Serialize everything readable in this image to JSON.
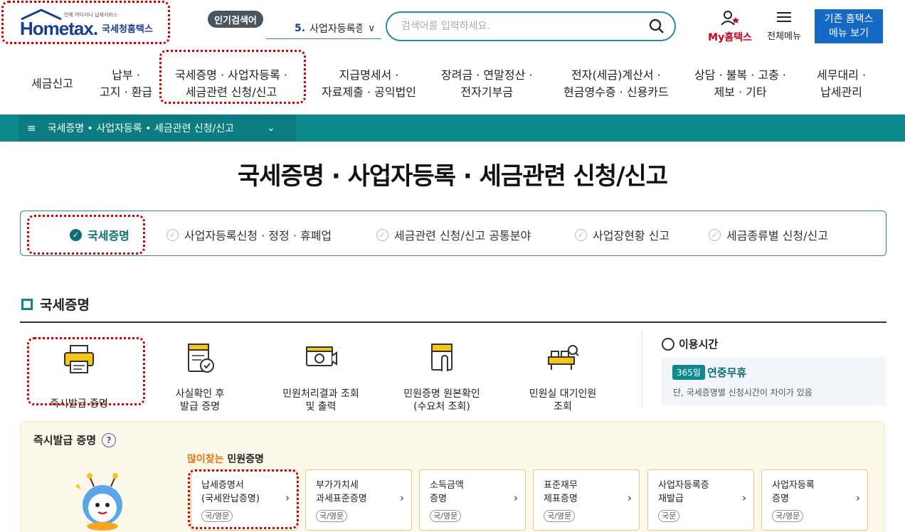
{
  "header": {
    "logo_main": "Hometax.",
    "logo_sub": "국세청홈택스",
    "logo_tiny": "언제 어디서나 납세서비스",
    "popular_badge": "인기검색어",
    "popular_num": "5.",
    "popular_text": "사업자등록증",
    "search_placeholder": "검색어를 입력하세요.",
    "my_label": "My홈택스",
    "all_menu_label": "전체메뉴",
    "old_btn_line1": "기존 홈택스",
    "old_btn_line2": "메뉴 보기"
  },
  "gnb": [
    {
      "l1": "세금신고",
      "l2": ""
    },
    {
      "l1": "납부 ·",
      "l2": "고지 · 환급"
    },
    {
      "l1": "국세증명 · 사업자등록 ·",
      "l2": "세금관련 신청/신고"
    },
    {
      "l1": "지급명세서 ·",
      "l2": "자료제출 · 공익법인"
    },
    {
      "l1": "장려금 · 연말정산 ·",
      "l2": "전자기부금"
    },
    {
      "l1": "전자(세금)계산서 ·",
      "l2": "현금영수증 · 신용카드"
    },
    {
      "l1": "상담 · 불복 · 고충 ·",
      "l2": "제보 · 기타"
    },
    {
      "l1": "세무대리 ·",
      "l2": "납세관리"
    }
  ],
  "breadcrumb": {
    "label": "국세증명 • 사업자등록 • 세금관련 신청/신고"
  },
  "page_title": "국세증명 · 사업자등록 · 세금관련 신청/신고",
  "tabs": [
    {
      "label": "국세증명",
      "active": true
    },
    {
      "label": "사업자등록신청 · 정정 · 휴폐업",
      "active": false
    },
    {
      "label": "세금관련 신청/신고 공통분야",
      "active": false
    },
    {
      "label": "사업장현황 신고",
      "active": false
    },
    {
      "label": "세금종류별 신청/신고",
      "active": false
    }
  ],
  "section": {
    "title": "국세증명"
  },
  "services": [
    {
      "l1": "즉시발급 증명",
      "l2": "",
      "icon": "printer-icon"
    },
    {
      "l1": "사실확인 후",
      "l2": "발급 증명",
      "icon": "document-check-icon"
    },
    {
      "l1": "민원처리결과 조회",
      "l2": "및 출력",
      "icon": "monitor-play-icon"
    },
    {
      "l1": "민원증명 원본확인",
      "l2": "(수요처 조회)",
      "icon": "document-touch-icon"
    },
    {
      "l1": "민원실 대기인원",
      "l2": "조회",
      "icon": "queue-search-icon"
    }
  ],
  "usage": {
    "title": "이용시간",
    "tag": "365일",
    "main": "연중무휴",
    "note": "단, 국세증명별 신청시간이 차이가 있음"
  },
  "instant": {
    "title": "즉시발급 증명",
    "help": "?",
    "popular_hi": "많이찾는",
    "popular_rest": " 민원증명",
    "cards": [
      {
        "l1": "납세증명서",
        "l2": "(국세완납증명)",
        "tag": "국/영문"
      },
      {
        "l1": "부가가치세",
        "l2": "과세표준증명",
        "tag": "국/영문"
      },
      {
        "l1": "소득금액",
        "l2": "증명",
        "tag": "국/영문"
      },
      {
        "l1": "표준재무",
        "l2": "제표증명",
        "tag": "국/영문"
      },
      {
        "l1": "사업자등록증",
        "l2": "재발급",
        "tag": "국문"
      },
      {
        "l1": "사업자등록",
        "l2": "증명",
        "tag": "국/영문"
      }
    ]
  },
  "colors": {
    "teal": "#0c8a8e",
    "brand_blue": "#1b3f8f",
    "highlight_red": "#d10000",
    "accent_orange": "#e07a10"
  }
}
